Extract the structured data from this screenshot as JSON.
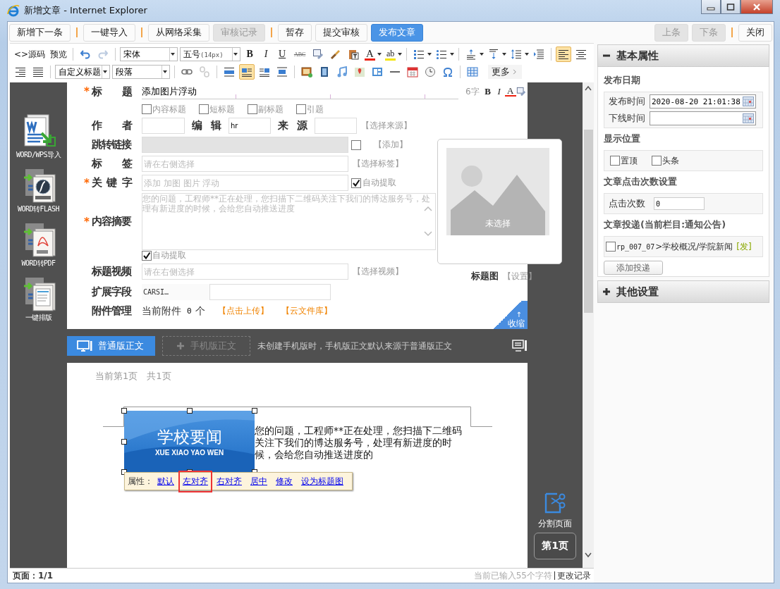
{
  "window": {
    "title": "新增文章 - Internet Explorer"
  },
  "actions": {
    "left": [
      [
        {
          "label": "新增下一条",
          "disabled": false,
          "primary": false
        }
      ],
      [
        {
          "label": "一键导入",
          "disabled": false,
          "primary": false
        }
      ],
      [
        {
          "label": "从网络采集",
          "disabled": false,
          "primary": false
        },
        {
          "label": "审核记录",
          "disabled": true,
          "primary": false
        }
      ],
      [
        {
          "label": "暂存",
          "disabled": false,
          "primary": false
        },
        {
          "label": "提交审核",
          "disabled": false,
          "primary": false
        },
        {
          "label": "发布文章",
          "disabled": false,
          "primary": true
        }
      ]
    ],
    "right": [
      [
        {
          "label": "上条",
          "disabled": true,
          "primary": false
        },
        {
          "label": "下条",
          "disabled": true,
          "primary": false
        }
      ],
      [
        {
          "label": "关闭",
          "disabled": false,
          "primary": false
        }
      ]
    ]
  },
  "toolbar": {
    "source": "<>源码",
    "preview": "预览",
    "font": "宋体",
    "size": "五号",
    "size_unit": "(14px)",
    "marks": [
      "B",
      "I",
      "U",
      "ABC"
    ],
    "font_color": "A",
    "bg_color": "ab",
    "heading": "自定义标题",
    "block": "段落",
    "more": "更多",
    "active": {
      "align_left": true,
      "align_center": false,
      "align_right": false,
      "justify": false,
      "float_none": false,
      "float_left": true,
      "float_right": false,
      "float_center": false
    }
  },
  "sidebar": [
    {
      "label": "WORD/WPS导入",
      "kind": "word"
    },
    {
      "label": "WORD转FLASH",
      "kind": "flash"
    },
    {
      "label": "WORD转PDF",
      "kind": "pdf"
    },
    {
      "label": "一键排版",
      "kind": "layout"
    }
  ],
  "form": {
    "required_mark": "*",
    "title": {
      "label": "标 题",
      "required": true,
      "value": "添加图片浮动",
      "count": "6字",
      "marks": [
        "B",
        "I",
        "A"
      ]
    },
    "title_options": [
      {
        "label": "内容标题",
        "checked": false
      },
      {
        "label": "短标题",
        "checked": false
      },
      {
        "label": "副标题",
        "checked": false
      },
      {
        "label": "引题",
        "checked": false
      }
    ],
    "author": {
      "label": "作 者",
      "editor_label": "编 辑",
      "editor": "hr",
      "source_label": "来 源",
      "source_link": "【选择来源】"
    },
    "redirect": {
      "label": "跳转链接",
      "disabled": true,
      "checked": false,
      "link": "【添加】"
    },
    "tags": {
      "label": "标 签",
      "placeholder": "请在右侧选择",
      "link": "【选择标签】"
    },
    "keywords": {
      "label": "关 键 字",
      "required": true,
      "placeholder": "添加 加图 图片 浮动",
      "auto_label": "自动提取",
      "auto_checked": true
    },
    "summary": {
      "label": "内容摘要",
      "required": true,
      "placeholder": "您的问题，工程师**正在处理，您扫描下二维码关注下我们的博达服务号，处理有新进度的时候，会给您自动推送进度",
      "auto_label": "自动提取",
      "auto_checked": true
    },
    "video": {
      "label": "标题视频",
      "placeholder": "请在右侧选择",
      "link": "【选择视频】"
    },
    "extension": {
      "label": "扩展字段",
      "name": "CARSI…"
    },
    "attachments": {
      "label": "附件管理",
      "current": "当前附件",
      "count": "0",
      "unit": "个",
      "upload": "【点击上传】",
      "library": "【云文件库】"
    },
    "thumbnail": {
      "placeholder": "未选择",
      "label": "标题图",
      "link": "【设置】"
    },
    "collapse": {
      "arrow": "↑",
      "label": "收缩"
    }
  },
  "body_tabs": [
    {
      "label": "普通版正文",
      "selected": true
    },
    {
      "label": "手机版正文",
      "selected": false
    }
  ],
  "body_hint": "未创建手机版时，手机版正文默认来源于普通版正文",
  "document": {
    "page_info": "当前第1页　共1页",
    "image": {
      "title": "学校要闻",
      "subtitle": "XUE XIAO YAO WEN"
    },
    "text": "您的问题，工程师**正在处理，您扫描下二维码关注下我们的博达服务号，处理有新进度的时候，会给您自动推送进度的",
    "menu_label": "属性：",
    "menu": [
      {
        "label": "默认",
        "selected": false
      },
      {
        "label": "左对齐",
        "selected": true
      },
      {
        "label": "右对齐",
        "selected": false
      },
      {
        "label": "居中",
        "selected": false
      },
      {
        "label": "修改",
        "selected": false
      },
      {
        "label": "设为标题图",
        "selected": false
      }
    ],
    "split_label": "分割页面",
    "page_button": "第1页"
  },
  "status_bar": {
    "page": "页面：1/1",
    "chars": "当前已输入55个字符",
    "history": "更改记录"
  },
  "panel": {
    "basic": {
      "title": "基本属性",
      "expanded": true,
      "date": {
        "heading": "发布日期",
        "publish_label": "发布时间",
        "publish_value": "2020-08-20 21:01:38",
        "offline_label": "下线时间"
      },
      "display": {
        "heading": "显示位置",
        "options": [
          {
            "label": "置顶",
            "checked": false
          },
          {
            "label": "头条",
            "checked": false
          }
        ]
      },
      "clicks": {
        "heading": "文章点击次数设置",
        "label": "点击次数",
        "value": "0"
      },
      "delivery": {
        "heading": "文章投递(当前栏目:通知公告)",
        "items": [
          {
            "code": "rp_007_07",
            "path": ">学校概况/学院新闻",
            "tag": "[发]",
            "checked": false
          }
        ],
        "button": "添加投递"
      }
    },
    "other": {
      "title": "其他设置",
      "expanded": false
    }
  }
}
